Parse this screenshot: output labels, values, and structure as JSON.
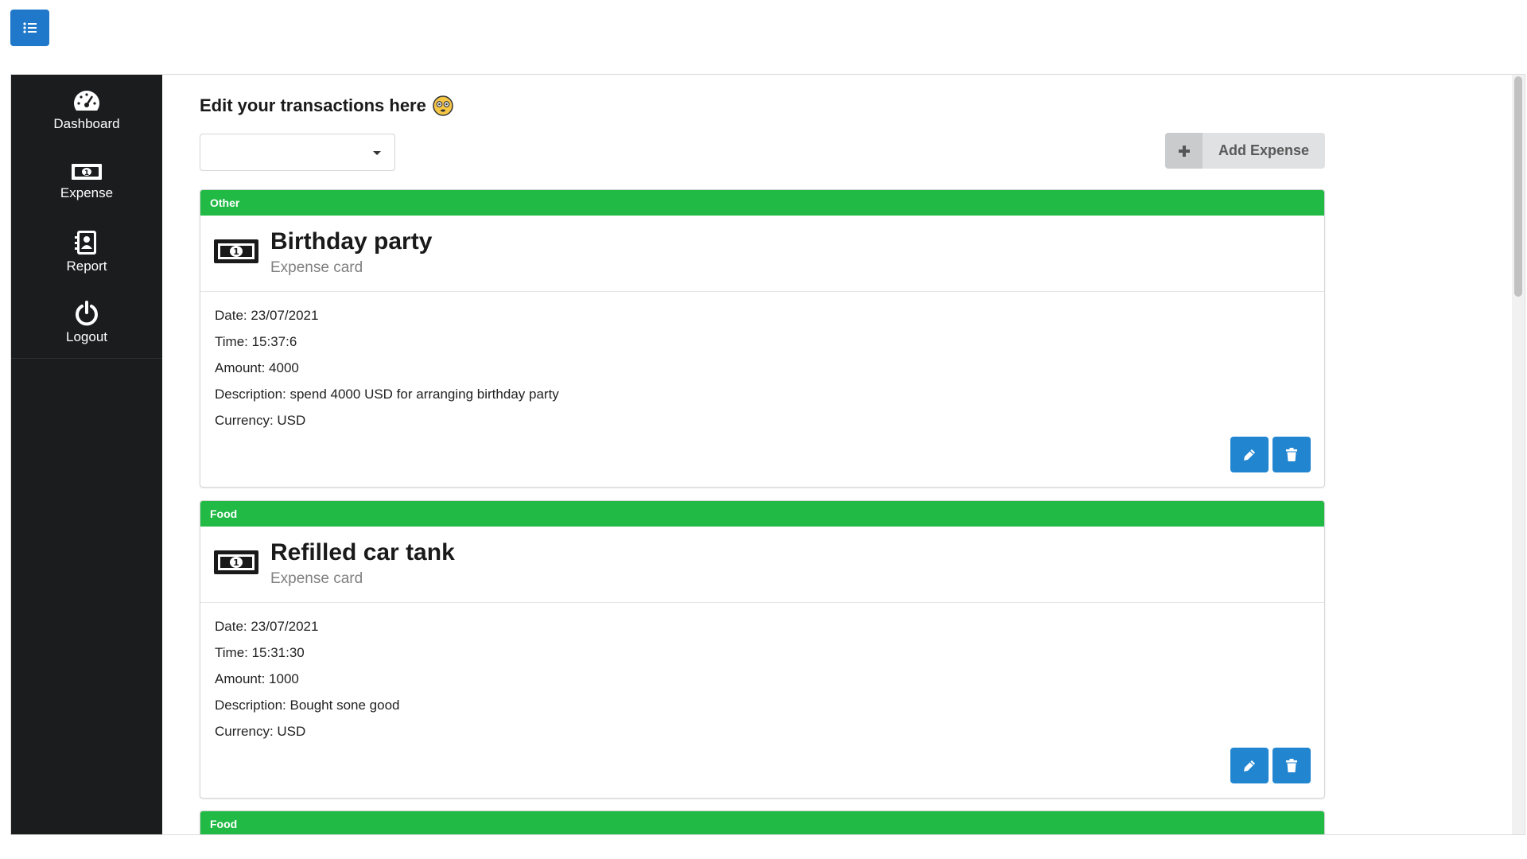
{
  "header": {
    "menu_icon": "list-icon"
  },
  "sidebar": {
    "items": [
      {
        "label": "Dashboard",
        "icon": "tachometer-icon"
      },
      {
        "label": "Expense",
        "icon": "money-bill-icon"
      },
      {
        "label": "Report",
        "icon": "address-book-icon"
      },
      {
        "label": "Logout",
        "icon": "power-icon"
      }
    ]
  },
  "main": {
    "title": "Edit your transactions here",
    "title_emoji": "flushed-face-emoji",
    "filter": {
      "value": ""
    },
    "add_button": {
      "label": "Add Expense",
      "icon": "plus-icon"
    },
    "cards": [
      {
        "category": "Other",
        "title": "Birthday party",
        "subtitle": "Expense card",
        "date": "Date: 23/07/2021",
        "time": "Time: 15:37:6",
        "amount": "Amount: 4000",
        "description": "Description: spend 4000 USD for arranging birthday party",
        "currency": "Currency: USD"
      },
      {
        "category": "Food",
        "title": "Refilled car tank",
        "subtitle": "Expense card",
        "date": "Date: 23/07/2021",
        "time": "Time: 15:31:30",
        "amount": "Amount: 1000",
        "description": "Description: Bought sone good",
        "currency": "Currency: USD"
      },
      {
        "category": "Food"
      }
    ]
  },
  "colors": {
    "primary_blue": "#2185d0",
    "category_green": "#21ba45",
    "sidebar_bg": "#1b1c1d",
    "add_button_bg": "#e0e1e2"
  }
}
